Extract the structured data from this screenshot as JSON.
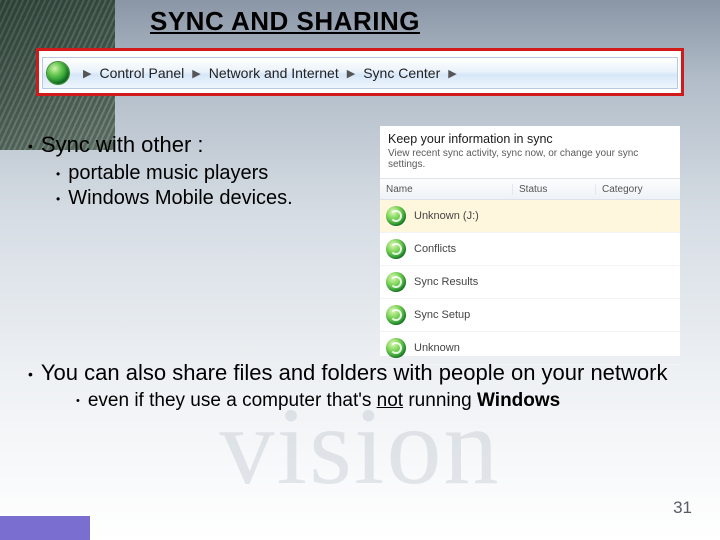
{
  "title": "SYNC AND SHARING",
  "watermark": "vision",
  "page_number": "31",
  "breadcrumb": {
    "items": [
      "Control Panel",
      "Network and Internet",
      "Sync Center"
    ]
  },
  "bullets": {
    "p1": "Sync with other :",
    "p1a": "portable music players",
    "p1b": "Windows Mobile devices.",
    "p2": "You can also share files and folders with people on your network",
    "p2a_pre": "even if they use a computer that's ",
    "p2a_not": "not",
    "p2a_post": " running ",
    "p2a_win": "Windows"
  },
  "sync_panel": {
    "heading": "Keep your information in sync",
    "sub": "View recent sync activity, sync now, or change your sync settings.",
    "cols": {
      "name": "Name",
      "status": "Status",
      "category": "Category"
    },
    "rows": [
      "Unknown (J:)",
      "Conflicts",
      "Sync Results",
      "Sync Setup",
      "Unknown"
    ]
  }
}
